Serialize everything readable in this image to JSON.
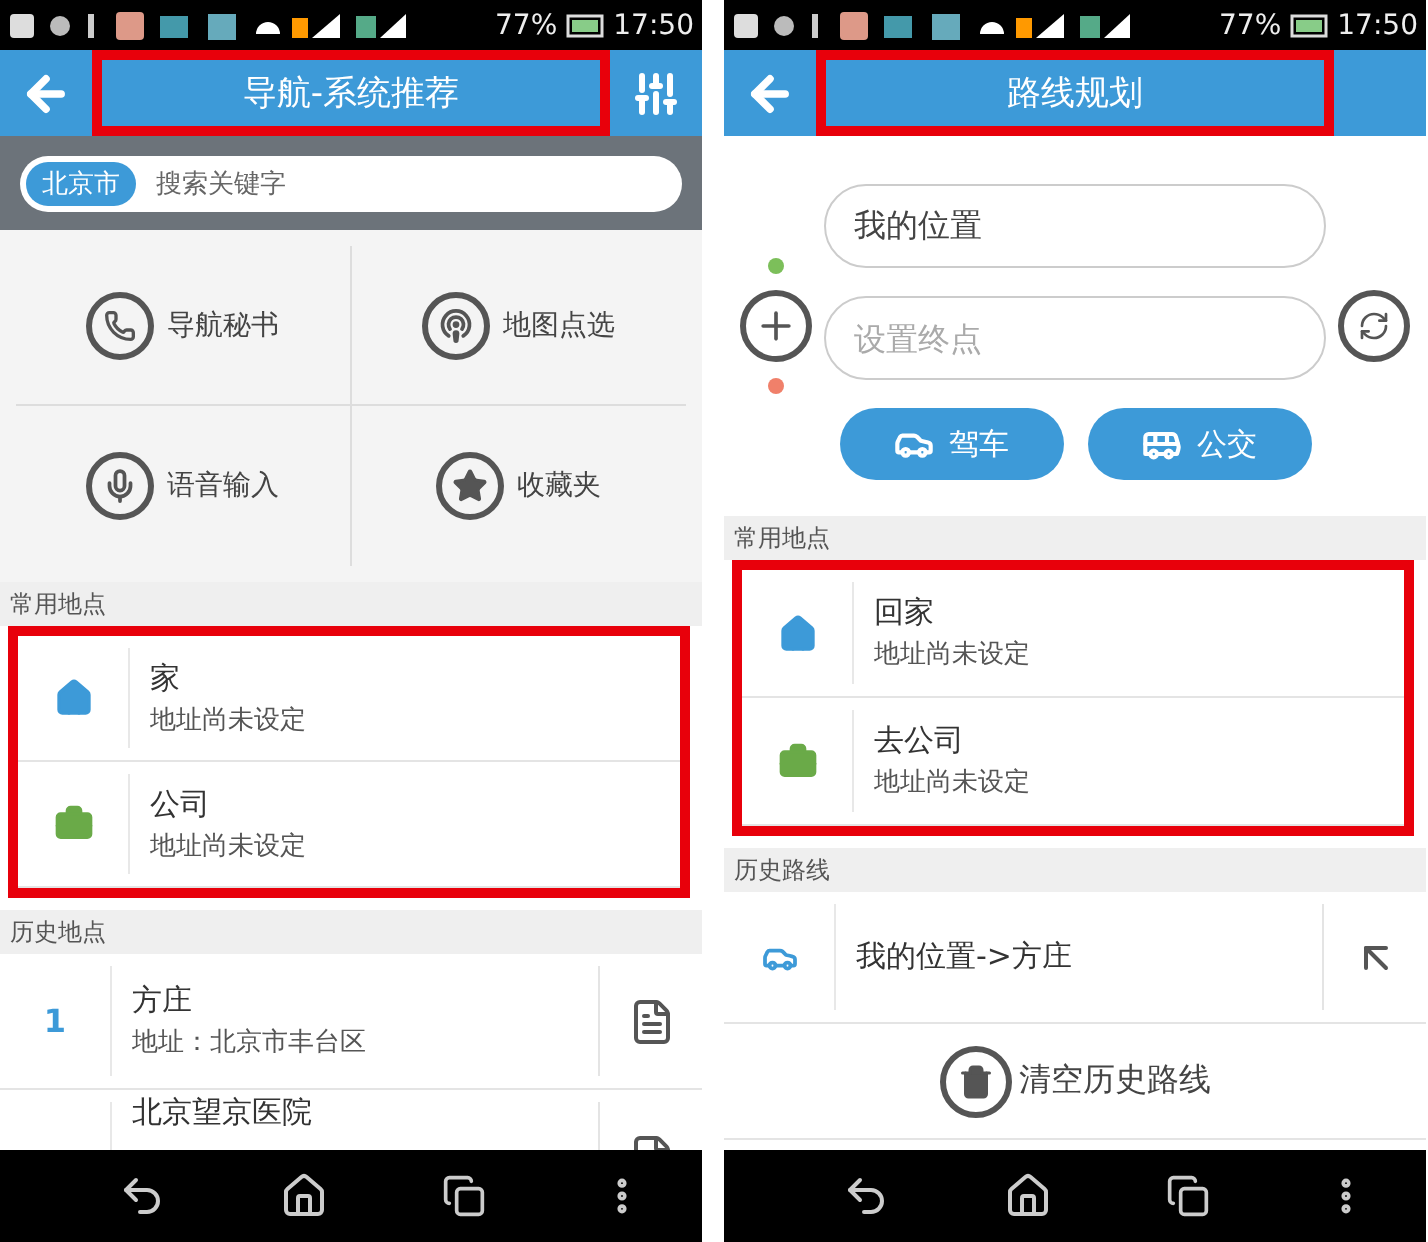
{
  "left_screen": {
    "status_bar": {
      "battery": "77%",
      "time": "17:50"
    },
    "app_bar": {
      "title": "导航-系统推荐",
      "highlighted": true
    },
    "search": {
      "city": "北京市",
      "placeholder": "搜索关键字"
    },
    "shortcuts": [
      {
        "label": "导航秘书",
        "kind": "phone"
      },
      {
        "label": "地图点选",
        "kind": "pin"
      },
      {
        "label": "语音输入",
        "kind": "mic"
      },
      {
        "label": "收藏夹",
        "kind": "star"
      }
    ],
    "favorites": {
      "heading": "常用地点",
      "highlighted": true,
      "items": [
        {
          "name": "家",
          "address": "地址尚未设定",
          "kind": "home"
        },
        {
          "name": "公司",
          "address": "地址尚未设定",
          "kind": "work"
        }
      ]
    },
    "history": {
      "heading": "历史地点",
      "items": [
        {
          "index": "1",
          "name": "方庄",
          "address": "地址：北京市丰台区"
        },
        {
          "name": "北京望京医院"
        }
      ]
    }
  },
  "right_screen": {
    "status_bar": {
      "battery": "77%",
      "time": "17:50"
    },
    "app_bar": {
      "title": "路线规划",
      "highlighted": true
    },
    "route": {
      "start": {
        "value": "我的位置"
      },
      "end": {
        "placeholder": "设置终点"
      },
      "modes": [
        {
          "label": "驾车",
          "kind": "car"
        },
        {
          "label": "公交",
          "kind": "bus"
        }
      ]
    },
    "favorites": {
      "heading": "常用地点",
      "highlighted": true,
      "items": [
        {
          "name": "回家",
          "address": "地址尚未设定",
          "kind": "home"
        },
        {
          "name": "去公司",
          "address": "地址尚未设定",
          "kind": "work"
        }
      ]
    },
    "history": {
      "heading": "历史路线",
      "items": [
        {
          "text": "我的位置->方庄",
          "kind": "car"
        }
      ]
    },
    "clear_button": "清空历史路线"
  }
}
